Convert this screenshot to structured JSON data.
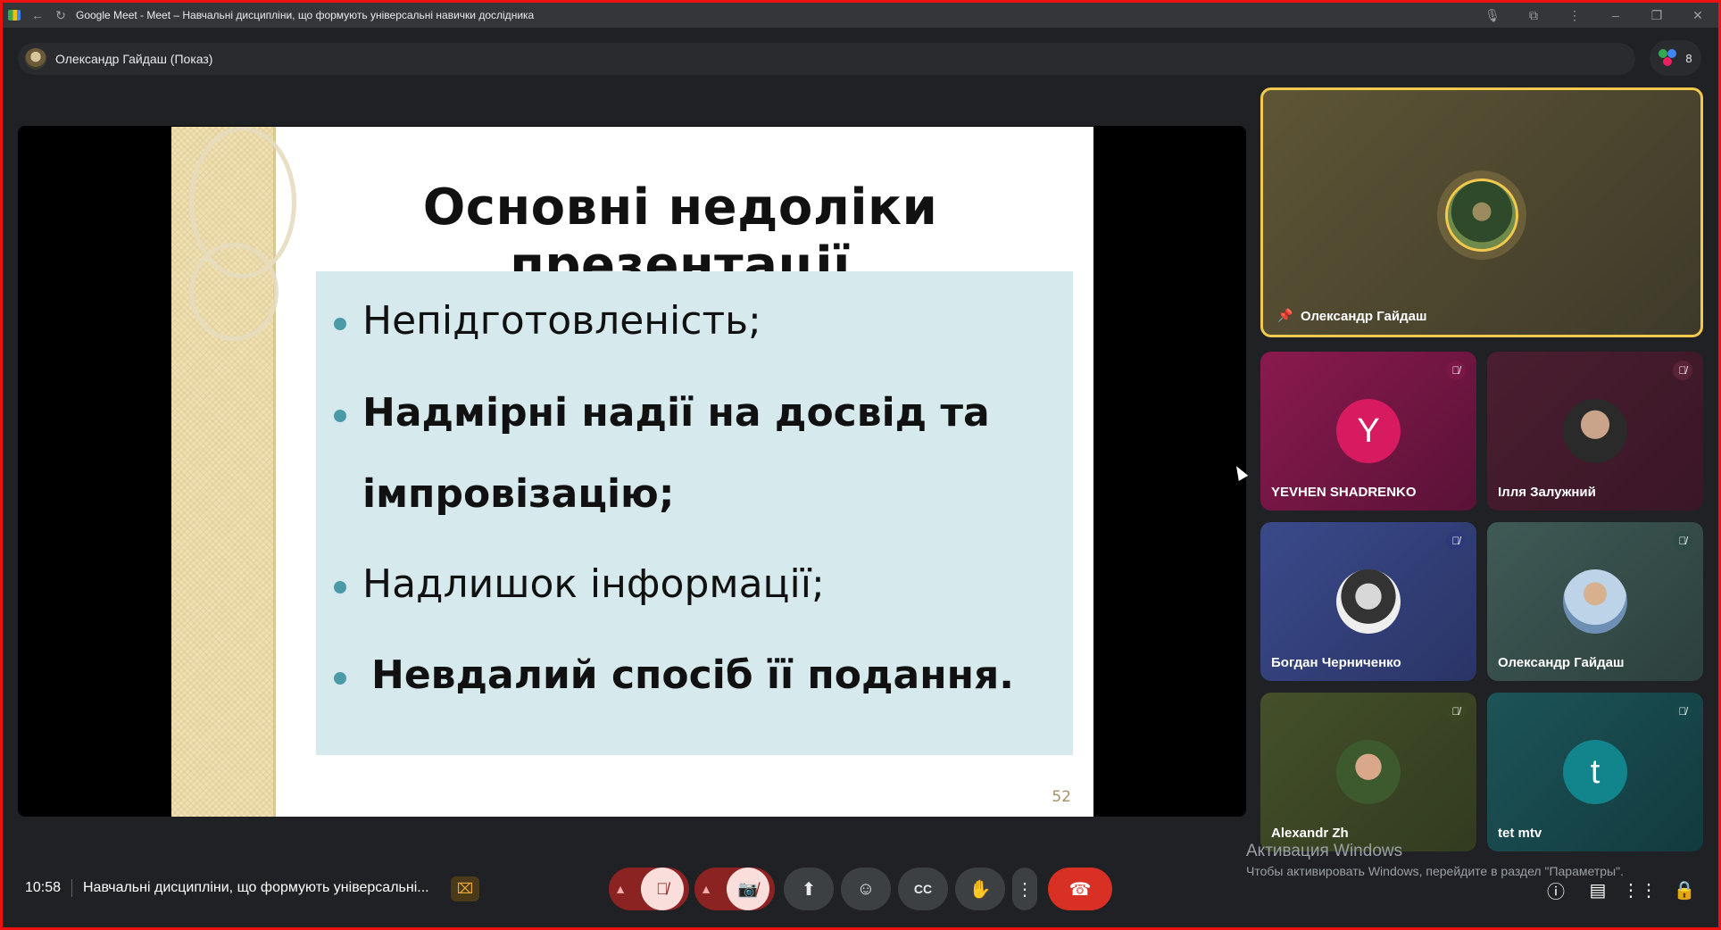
{
  "browser": {
    "title": "Google Meet - Meet – Навчальні дисципліни, що формують універсальні навички дослідника",
    "icons": [
      "back-icon",
      "reload-icon",
      "mic-icon",
      "extensions-icon",
      "menu-icon",
      "minimize-icon",
      "restore-icon",
      "close-icon"
    ]
  },
  "presenter": {
    "label": "Олександр Гайдаш (Показ)"
  },
  "people": {
    "count": "8"
  },
  "slide": {
    "title": "Основні недоліки презентації",
    "bullets": [
      "Непідготовленість;",
      "Надмірні надії на досвід та",
      "імпровізацію;",
      "Надлишок інформації;",
      "Невдалий спосіб її подання."
    ],
    "page_number": "52"
  },
  "participants": {
    "pinned": {
      "name": "Олександр Гайдаш"
    },
    "tiles": [
      {
        "name": "YEVHEN SHADRENKO",
        "initial": "Y",
        "color": "#d81b60"
      },
      {
        "name": "Ілля Залужний"
      },
      {
        "name": "Богдан Черниченко"
      },
      {
        "name": "Олександр Гайдаш"
      },
      {
        "name": "Alexandr Zh"
      },
      {
        "name": "tet mtv",
        "initial": "t",
        "color": "#12848c"
      }
    ]
  },
  "bottom": {
    "time": "10:58",
    "meeting_title": "Навчальні дисципліни, що формують універсальні...",
    "windows_activation_title": "Активация Windows",
    "windows_activation_text": "Чтобы активировать Windows, перейдите в раздел \"Параметры\"."
  },
  "colors": {
    "accent_red": "#d93025",
    "pinned_border": "#f2c94c",
    "bg": "#202124"
  }
}
